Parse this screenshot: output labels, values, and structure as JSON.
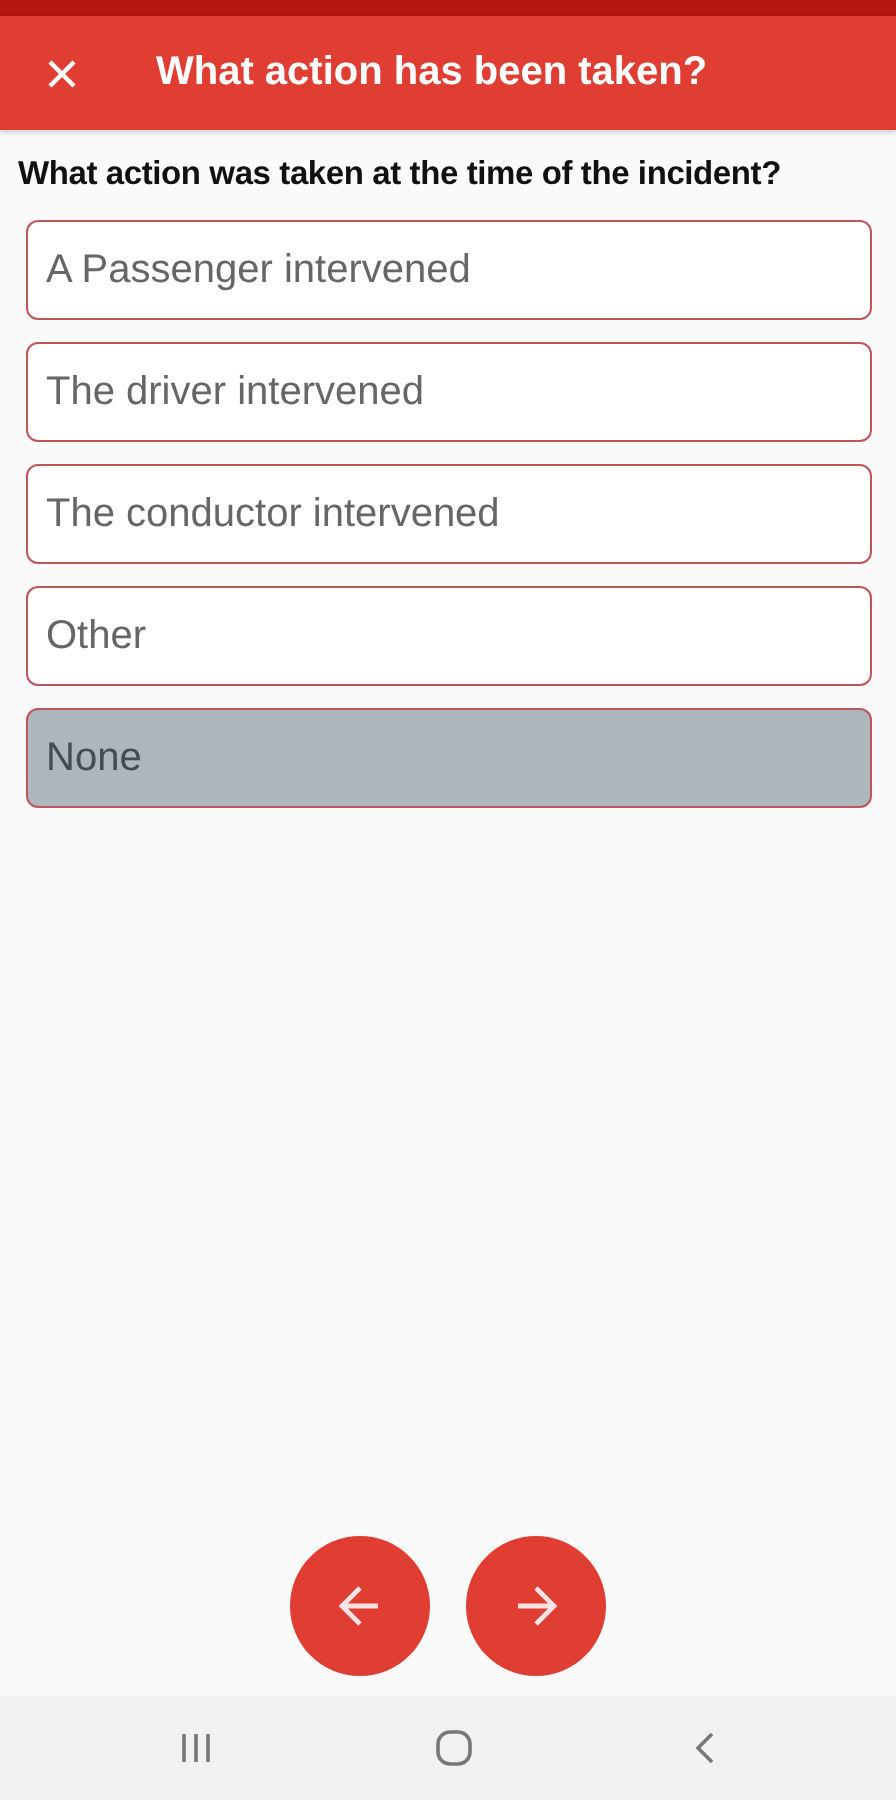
{
  "header": {
    "title": "What action has been taken?"
  },
  "question": "What action was taken at the time of the incident?",
  "options": [
    {
      "label": "A Passenger intervened",
      "selected": false
    },
    {
      "label": "The driver intervened",
      "selected": false
    },
    {
      "label": "The conductor intervened",
      "selected": false
    },
    {
      "label": "Other",
      "selected": false
    },
    {
      "label": "None",
      "selected": true
    }
  ]
}
